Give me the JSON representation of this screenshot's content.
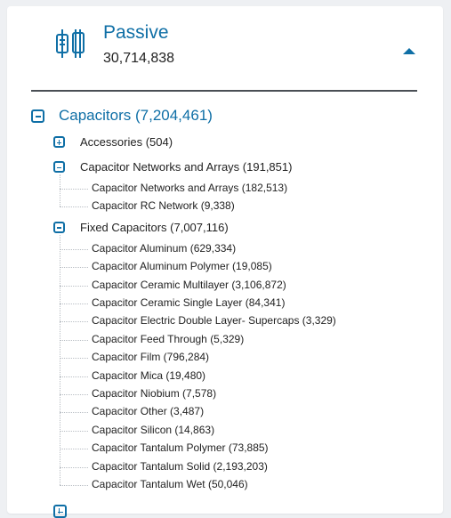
{
  "category": {
    "title": "Passive",
    "count": "30,714,838",
    "icon": "passive-components-icon",
    "accent": "#0f6fa6"
  },
  "group": {
    "label": "Capacitors (7,204,461)",
    "expanded": true
  },
  "subgroups": [
    {
      "label": "Accessories (504)",
      "expanded": false,
      "items": []
    },
    {
      "label": "Capacitor Networks and Arrays (191,851)",
      "expanded": true,
      "items": [
        "Capacitor Networks and Arrays (182,513)",
        "Capacitor RC Network (9,338)"
      ]
    },
    {
      "label": "Fixed Capacitors (7,007,116)",
      "expanded": true,
      "items": [
        "Capacitor Aluminum (629,334)",
        "Capacitor Aluminum Polymer (19,085)",
        "Capacitor Ceramic Multilayer (3,106,872)",
        "Capacitor Ceramic Single Layer (84,341)",
        "Capacitor Electric Double Layer- Supercaps (3,329)",
        "Capacitor Feed Through (5,329)",
        "Capacitor Film (796,284)",
        "Capacitor Mica (19,480)",
        "Capacitor Niobium (7,578)",
        "Capacitor Other (3,487)",
        "Capacitor Silicon (14,863)",
        "Capacitor Tantalum Polymer (73,885)",
        "Capacitor Tantalum Solid (2,193,203)",
        "Capacitor Tantalum Wet (50,046)"
      ]
    }
  ]
}
